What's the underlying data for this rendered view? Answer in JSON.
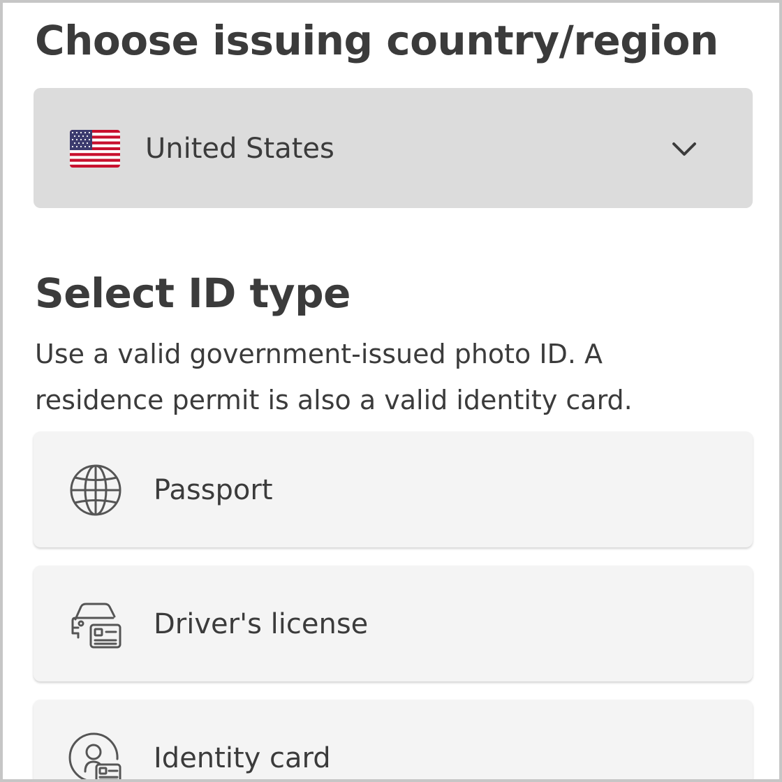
{
  "country_section": {
    "title": "Choose issuing country/region",
    "selected_country": "United States",
    "flag_icon": "us-flag-icon",
    "dropdown_icon": "chevron-down-icon"
  },
  "id_section": {
    "title": "Select ID type",
    "description": "Use a valid government-issued photo ID. A residence permit is also a valid identity card.",
    "options": [
      {
        "label": "Passport",
        "icon": "globe-icon"
      },
      {
        "label": "Driver's license",
        "icon": "car-id-card-icon"
      },
      {
        "label": "Identity card",
        "icon": "person-id-card-icon"
      }
    ]
  },
  "colors": {
    "select_background": "#dcdcdc",
    "option_background": "#f4f4f4",
    "text": "#3b3b3b",
    "frame_border": "#c6c6c6"
  }
}
